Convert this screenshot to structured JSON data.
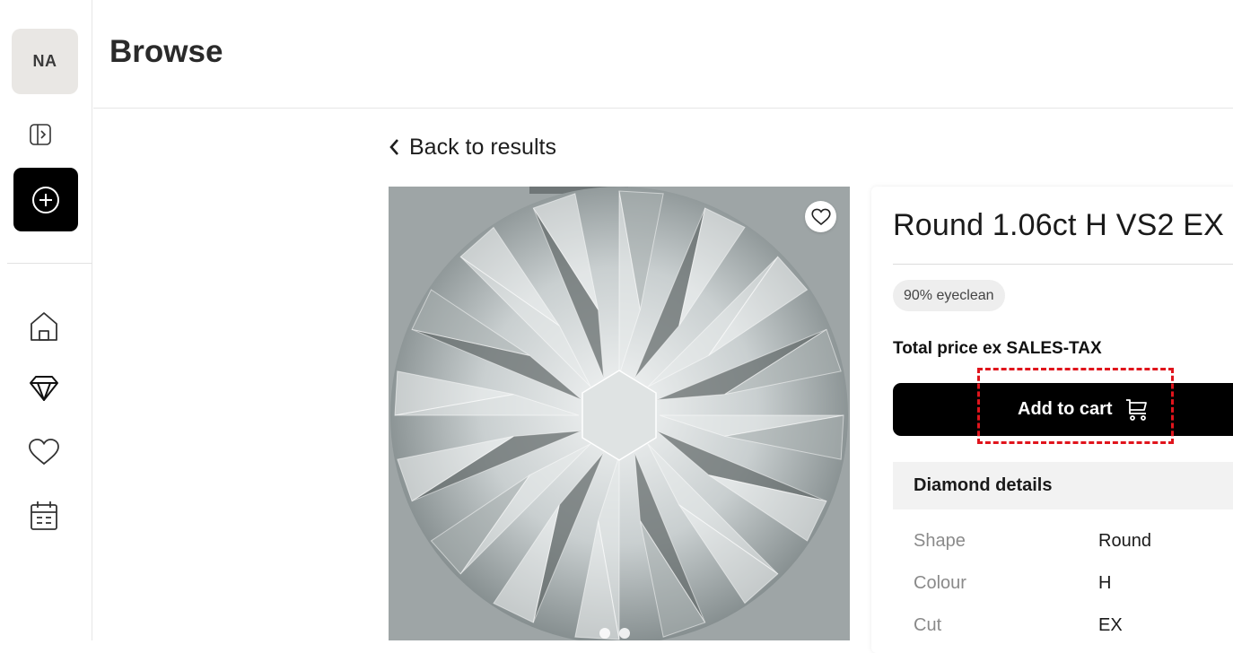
{
  "sidebar": {
    "avatar_initials": "NA",
    "icons": [
      "sidebar-toggle-icon",
      "plus-circle-icon",
      "home-icon",
      "diamond-icon",
      "heart-icon",
      "calendar-icon"
    ]
  },
  "header": {
    "title": "Browse"
  },
  "main": {
    "back_label": "Back to results",
    "product": {
      "title": "Round 1.06ct H VS2 EX",
      "badge": "90% eyeclean",
      "price_label": "Total price ex SALES-TAX",
      "cart_label": "Add to cart",
      "details_title": "Diamond details",
      "details": [
        {
          "key": "Shape",
          "value": "Round"
        },
        {
          "key": "Colour",
          "value": "H"
        },
        {
          "key": "Cut",
          "value": "EX"
        }
      ]
    },
    "carousel_dots": 2
  },
  "colors": {
    "primary_button": "#000000",
    "highlight": "#e0141c",
    "image_background": "#9ea5a6"
  }
}
